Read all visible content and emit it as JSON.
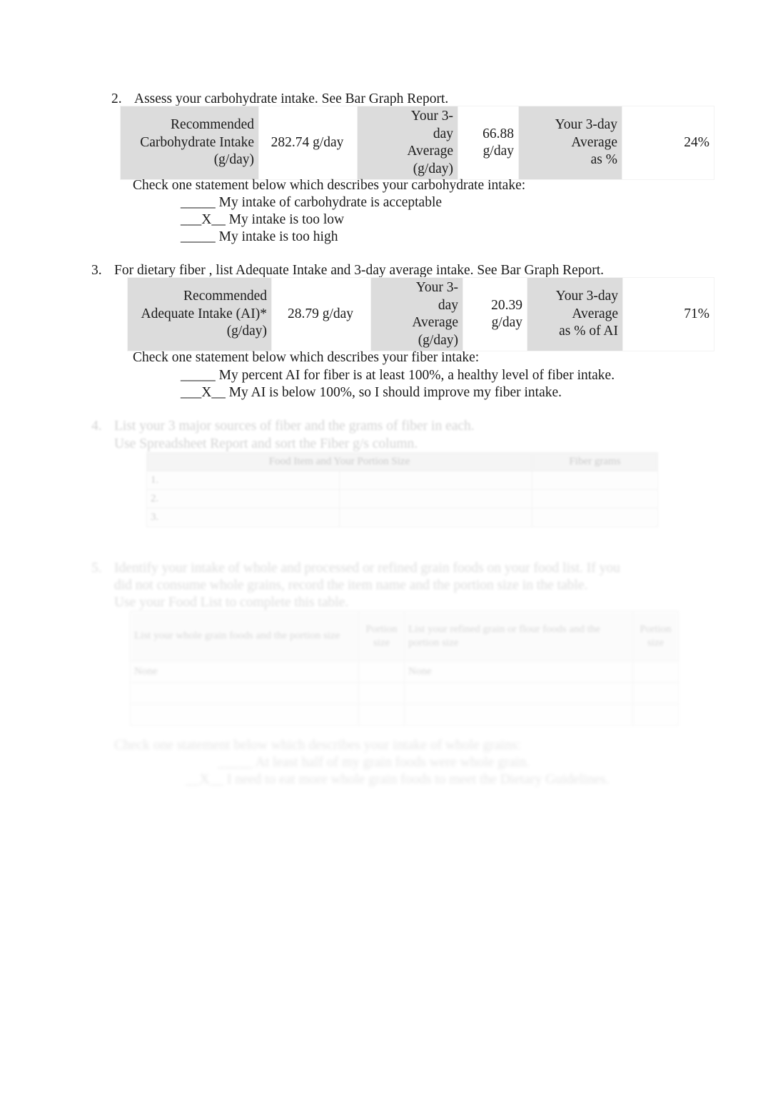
{
  "document": {
    "kind": "nutrition-assessment-worksheet"
  },
  "section_carbohydrate": {
    "number": "2.",
    "prompt": "Assess your carbohydrate   intake.  See Bar Graph Report.",
    "table": {
      "recommended_label": "Recommended Carbohydrate Intake (g/day)",
      "recommended_label_lines": [
        "Recommended",
        "Carbohydrate Intake",
        "(g/day)"
      ],
      "recommended_value": "282.74 g/day",
      "average_label_lines": [
        "Your 3-",
        "day",
        "Average",
        "(g/day)"
      ],
      "average_value_lines": [
        "66.88",
        "g/day"
      ],
      "percent_label_lines": [
        "Your 3-day",
        "Average",
        "as %"
      ],
      "percent_value": "24%"
    },
    "check_prompt": "Check  one statement below which describes your carbohydrate intake:",
    "options": [
      {
        "mark": "_____",
        "text": "My intake of carbohydrate is acceptable",
        "checked": false
      },
      {
        "mark": "___X__",
        "text": "My intake is too low",
        "checked": true
      },
      {
        "mark": "_____",
        "text": "My intake is too high",
        "checked": false
      }
    ]
  },
  "section_fiber": {
    "number": "3.",
    "prompt": "For dietary fiber  , list Adequate Intake and 3-day average intake. See Bar Graph Report.",
    "table": {
      "recommended_label_lines": [
        "Recommended",
        "Adequate Intake (AI)*",
        "(g/day)"
      ],
      "recommended_value": "28.79 g/day",
      "average_label_lines": [
        "Your 3-",
        "day",
        "Average",
        "(g/day)"
      ],
      "average_value_lines": [
        "20.39",
        "g/day"
      ],
      "percent_label_lines": [
        "Your 3-day",
        "Average",
        "as % of AI"
      ],
      "percent_value": "71%"
    },
    "check_prompt": "Check  one statement below which describes your fiber intake:",
    "options": [
      {
        "mark": "_____",
        "text": "My percent AI for fiber is at least 100%, a healthy level of fiber intake.",
        "checked": false
      },
      {
        "mark": "___X__",
        "text": "My AI is below 100%, so I should improve my fiber intake.",
        "checked": true
      }
    ]
  },
  "section_fiber_sources": {
    "number": "4.",
    "prompt_line_1": "List your 3 major sources of fiber and the grams of fiber in each.",
    "prompt_line_2": "Use Spreadsheet Report and sort the Fiber g/s column.",
    "table": {
      "headers": [
        "Food Item and Your Portion Size",
        "Fiber grams"
      ],
      "rows": [
        {
          "index": "1.",
          "food": "",
          "grams": ""
        },
        {
          "index": "2.",
          "food": "",
          "grams": ""
        },
        {
          "index": "3.",
          "food": "",
          "grams": ""
        }
      ]
    }
  },
  "section_whole_grains": {
    "number": "5.",
    "prompt_line_1": "Identify your intake of whole and processed or refined grain foods on your food list.  If you",
    "prompt_line_2": "did not consume whole grains, record the item name and the portion size in the table.",
    "prompt_line_3": "Use your Food List to complete this table.",
    "table": {
      "headers": [
        "List your whole grain foods and the portion size",
        "Portion size",
        "List your refined grain or flour foods and the portion size",
        "Portion size"
      ],
      "rows": [
        {
          "whole": "None",
          "whole_size": "",
          "refined": "None",
          "refined_size": ""
        },
        {
          "whole": "",
          "whole_size": "",
          "refined": "",
          "refined_size": ""
        },
        {
          "whole": "",
          "whole_size": "",
          "refined": "",
          "refined_size": ""
        }
      ]
    },
    "check_prompt": "Check  one statement below which describes your intake of whole grains:",
    "options": [
      {
        "mark": "_____",
        "text": "At least half of my grain foods were whole grain.",
        "checked": false
      },
      {
        "mark": "__X__",
        "text": "I need to eat more whole grain foods to meet the Dietary Guidelines.",
        "checked": true
      }
    ]
  },
  "colors": {
    "label_cell": "#dcdcdc",
    "value_cell": "#ffffff",
    "text": "#1a1a1a",
    "ghost_border": "#c9c9c9"
  }
}
